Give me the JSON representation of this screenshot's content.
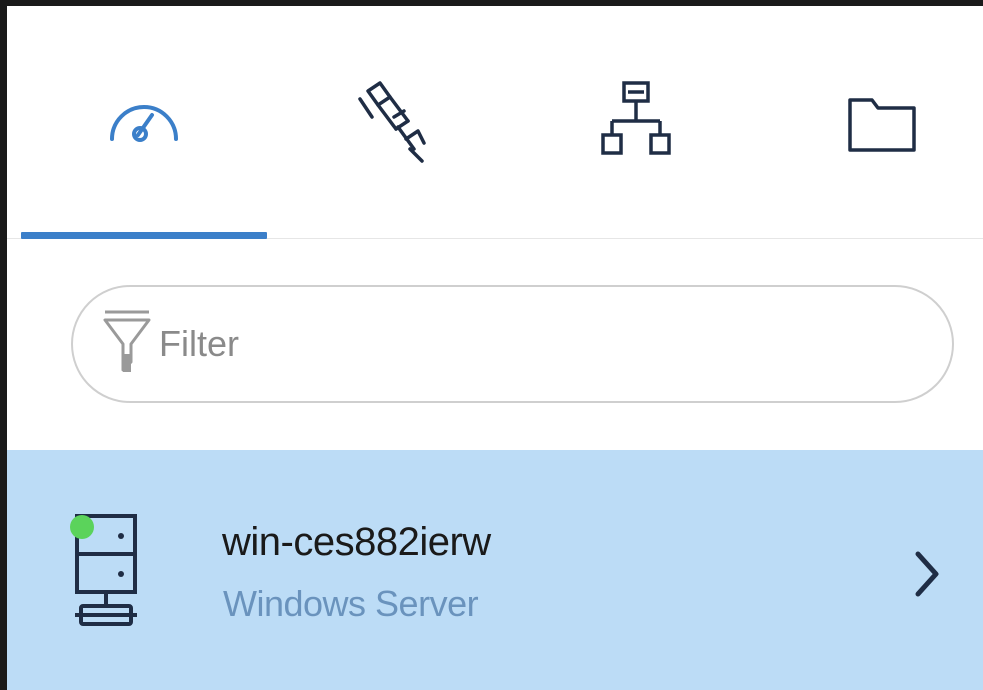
{
  "tabs": [
    {
      "icon": "dashboard-gauge-icon",
      "active": true
    },
    {
      "icon": "satellite-icon",
      "active": false
    },
    {
      "icon": "network-topology-icon",
      "active": false
    },
    {
      "icon": "folder-icon",
      "active": false
    }
  ],
  "filter": {
    "placeholder": "Filter",
    "value": "",
    "icon": "filter-funnel-icon"
  },
  "servers": [
    {
      "name": "win-ces882ierw",
      "type": "Windows Server",
      "status": "online",
      "icon": "server-icon"
    }
  ],
  "colors": {
    "accent": "#3b7fc9",
    "selected_row": "#bcdcf6",
    "status_online": "#5bd35b",
    "secondary_text": "#6a93bd",
    "icon_dark": "#1f2d45"
  }
}
